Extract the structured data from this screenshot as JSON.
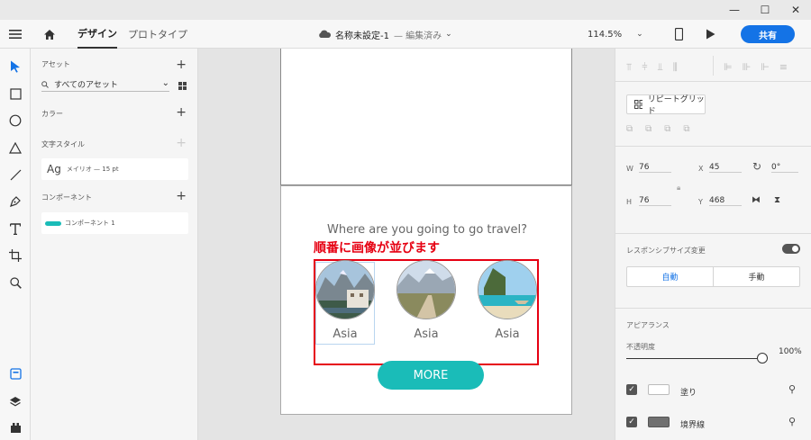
{
  "window": {
    "minimize": "—",
    "maximize": "☐",
    "close": "✕"
  },
  "topbar": {
    "tabs": [
      {
        "label": "デザイン"
      },
      {
        "label": "プロトタイプ"
      }
    ],
    "doc_title": "名称未設定-1",
    "doc_status": "— 編集済み",
    "zoom": "114.5%",
    "share_label": "共有"
  },
  "assets": {
    "title": "アセット",
    "filter_label": "すべてのアセット",
    "colors_title": "カラー",
    "text_styles_title": "文字スタイル",
    "text_style": {
      "sample": "Ag",
      "desc": "メイリオ — 15 pt"
    },
    "components_title": "コンポーネント",
    "component_name": "コンポーネント 1"
  },
  "artboard": {
    "heading": "Where are you going to go travel?",
    "annotation": "順番に画像が並びます",
    "cards": [
      {
        "label": "Asia"
      },
      {
        "label": "Asia"
      },
      {
        "label": "Asia"
      }
    ],
    "more_label": "MORE",
    "annotation_color": "#e60012",
    "more_color": "#1abcb8"
  },
  "props": {
    "repeat_grid_label": "リピートグリッド",
    "w_label": "W",
    "w_value": "76",
    "x_label": "X",
    "x_value": "45",
    "rot_value": "0°",
    "h_label": "H",
    "h_value": "76",
    "y_label": "Y",
    "y_value": "468",
    "responsive_label": "レスポンシブサイズ変更",
    "auto_label": "自動",
    "manual_label": "手動",
    "appearance_title": "アピアランス",
    "opacity_label": "不透明度",
    "opacity_value": "100%",
    "fill_label": "塗り",
    "border_label": "境界線",
    "accent_color": "#1473e6"
  }
}
